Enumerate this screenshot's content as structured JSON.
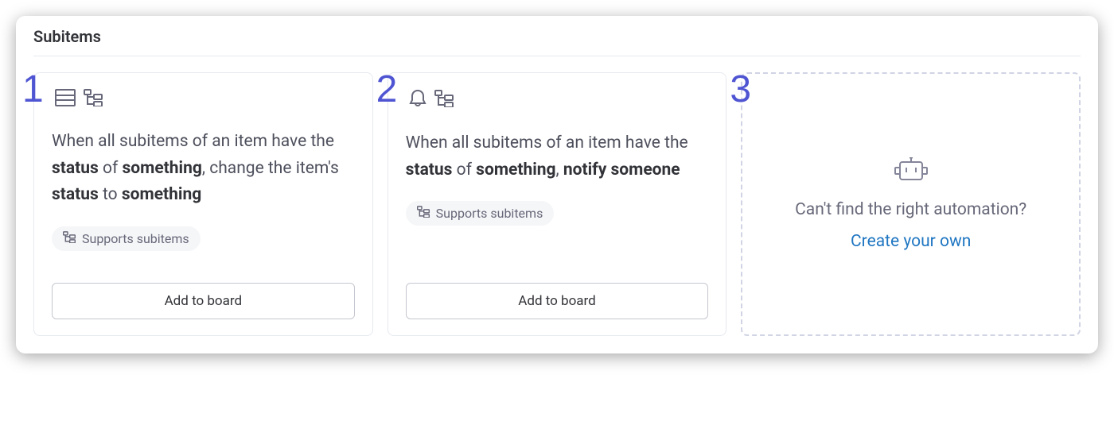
{
  "section": {
    "title": "Subitems"
  },
  "cards": [
    {
      "number": "1",
      "text_parts": {
        "p1": "When all subitems of an item have the ",
        "b1": "status",
        "p2": " of ",
        "b2": "something",
        "p3": ", change the item's ",
        "b3": "status",
        "p4": " to ",
        "b4": "something"
      },
      "pill_label": "Supports subitems",
      "button_label": "Add to board"
    },
    {
      "number": "2",
      "text_parts": {
        "p1": "When all subitems of an item have the ",
        "b1": "status",
        "p2": " of ",
        "b2": "something",
        "p3": ", ",
        "b3": "notify",
        "p4": " ",
        "b4": "someone"
      },
      "pill_label": "Supports subitems",
      "button_label": "Add to board"
    }
  ],
  "create": {
    "number": "3",
    "heading": "Can't find the right automation?",
    "link_label": "Create your own"
  }
}
